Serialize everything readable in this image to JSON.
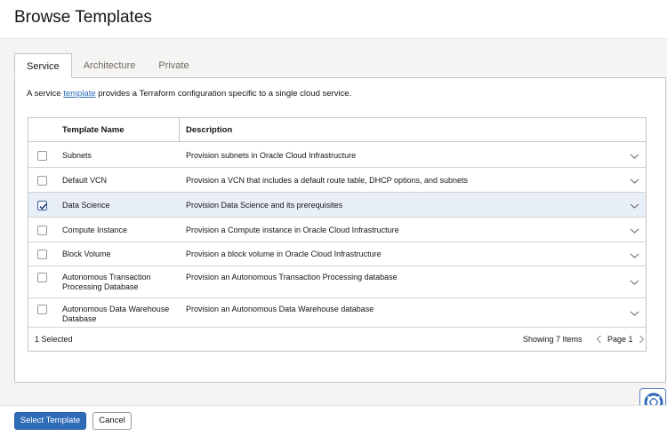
{
  "header": {
    "title": "Browse Templates"
  },
  "tabs": [
    {
      "label": "Service",
      "active": true
    },
    {
      "label": "Architecture",
      "active": false
    },
    {
      "label": "Private",
      "active": false
    }
  ],
  "description": {
    "prefix": "A service ",
    "link": "template",
    "suffix": " provides a Terraform configuration specific to a single cloud service."
  },
  "table": {
    "columns": [
      "Template Name",
      "Description"
    ],
    "rows": [
      {
        "name": "Subnets",
        "description": "Provision subnets in Oracle Cloud Infrastructure",
        "checked": false
      },
      {
        "name": "Default VCN",
        "description": "Provision a VCN that includes a default route table, DHCP options, and subnets",
        "checked": false
      },
      {
        "name": "Data Science",
        "description": "Provision Data Science and its prerequisites",
        "checked": true
      },
      {
        "name": "Compute Instance",
        "description": "Provision a Compute instance in Oracle Cloud Infrastructure",
        "checked": false
      },
      {
        "name": "Block Volume",
        "description": "Provision a block volume in Oracle Cloud Infrastructure",
        "checked": false
      },
      {
        "name": "Autonomous Transaction Processing Database",
        "description": "Provision an Autonomous Transaction Processing database",
        "checked": false
      },
      {
        "name": "Autonomous Data Warehouse Database",
        "description": "Provision an Autonomous Data Warehouse database",
        "checked": false
      }
    ],
    "footer": {
      "selected": "1 Selected",
      "showing": "Showing 7 Items",
      "page": "Page 1"
    }
  },
  "buttons": {
    "select": "Select Template",
    "cancel": "Cancel"
  },
  "colors": {
    "primary": "#2e6bb8",
    "selected_row": "#e8eff8",
    "link": "#2e6bb8"
  }
}
